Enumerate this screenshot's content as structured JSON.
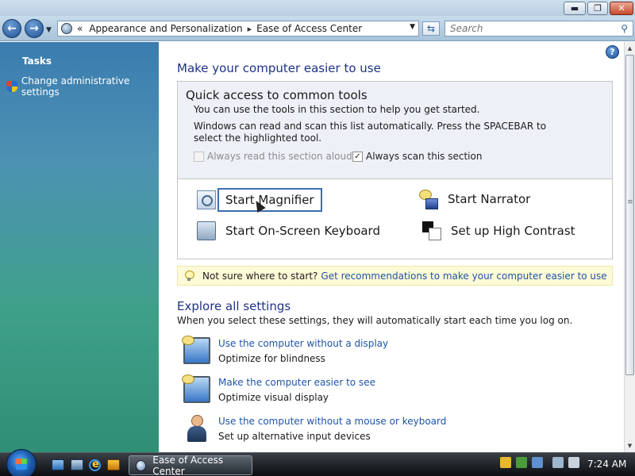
{
  "window": {
    "minimize_glyph": "▬",
    "maximize_glyph": "❐",
    "close_glyph": "✕"
  },
  "nav": {
    "back_glyph": "←",
    "forward_glyph": "→",
    "history_glyph": "▼"
  },
  "address": {
    "overflow_glyph": "«",
    "breadcrumbs": [
      "Appearance and Personalization",
      "Ease of Access Center"
    ],
    "separator": "▸",
    "dropdown_glyph": "▼"
  },
  "refresh_glyph": "⇆",
  "search": {
    "placeholder": "Search",
    "icon_glyph": "⚲"
  },
  "sidebar": {
    "tasks_heading": "Tasks",
    "admin_link": "Change administrative settings"
  },
  "main": {
    "help_glyph": "?",
    "title": "Make your computer easier to use",
    "quick_access": {
      "title": "Quick access to common tools",
      "desc1": "You can use the tools in this section to help you get started.",
      "desc2": "Windows can read and scan this list automatically.  Press the SPACEBAR to select the highlighted tool.",
      "read_aloud_label": "Always read this section aloud",
      "read_aloud_checked": false,
      "scan_label": "Always scan this section",
      "scan_checked": true,
      "check_glyph": "✓",
      "tools": {
        "magnifier": "Start Magnifier",
        "narrator": "Start Narrator",
        "keyboard": "Start On-Screen Keyboard",
        "contrast": "Set up High Contrast"
      }
    },
    "tip": {
      "prefix": "Not sure where to start?",
      "link": "Get recommendations to make your computer easier to use"
    },
    "explore": {
      "title": "Explore all settings",
      "desc": "When you select these settings, they will automatically start each time you log on.",
      "items": [
        {
          "link": "Use the computer without a display",
          "sub": "Optimize for blindness",
          "icon": "monitor-icon"
        },
        {
          "link": "Make the computer easier to see",
          "sub": "Optimize visual display",
          "icon": "monitor-icon"
        },
        {
          "link": "Use the computer without a mouse or keyboard",
          "sub": "Set up alternative input devices",
          "icon": "person-icon"
        }
      ]
    }
  },
  "scrollbar": {
    "up_glyph": "▲",
    "down_glyph": "▼"
  },
  "taskbar": {
    "active_window": "Ease of Access Center",
    "clock": "7:24 AM"
  },
  "colors": {
    "heading": "#1e3287",
    "link": "#1f54a8",
    "quick_access_bg": "#eef0f7",
    "tip_bg": "#fdfad7"
  }
}
